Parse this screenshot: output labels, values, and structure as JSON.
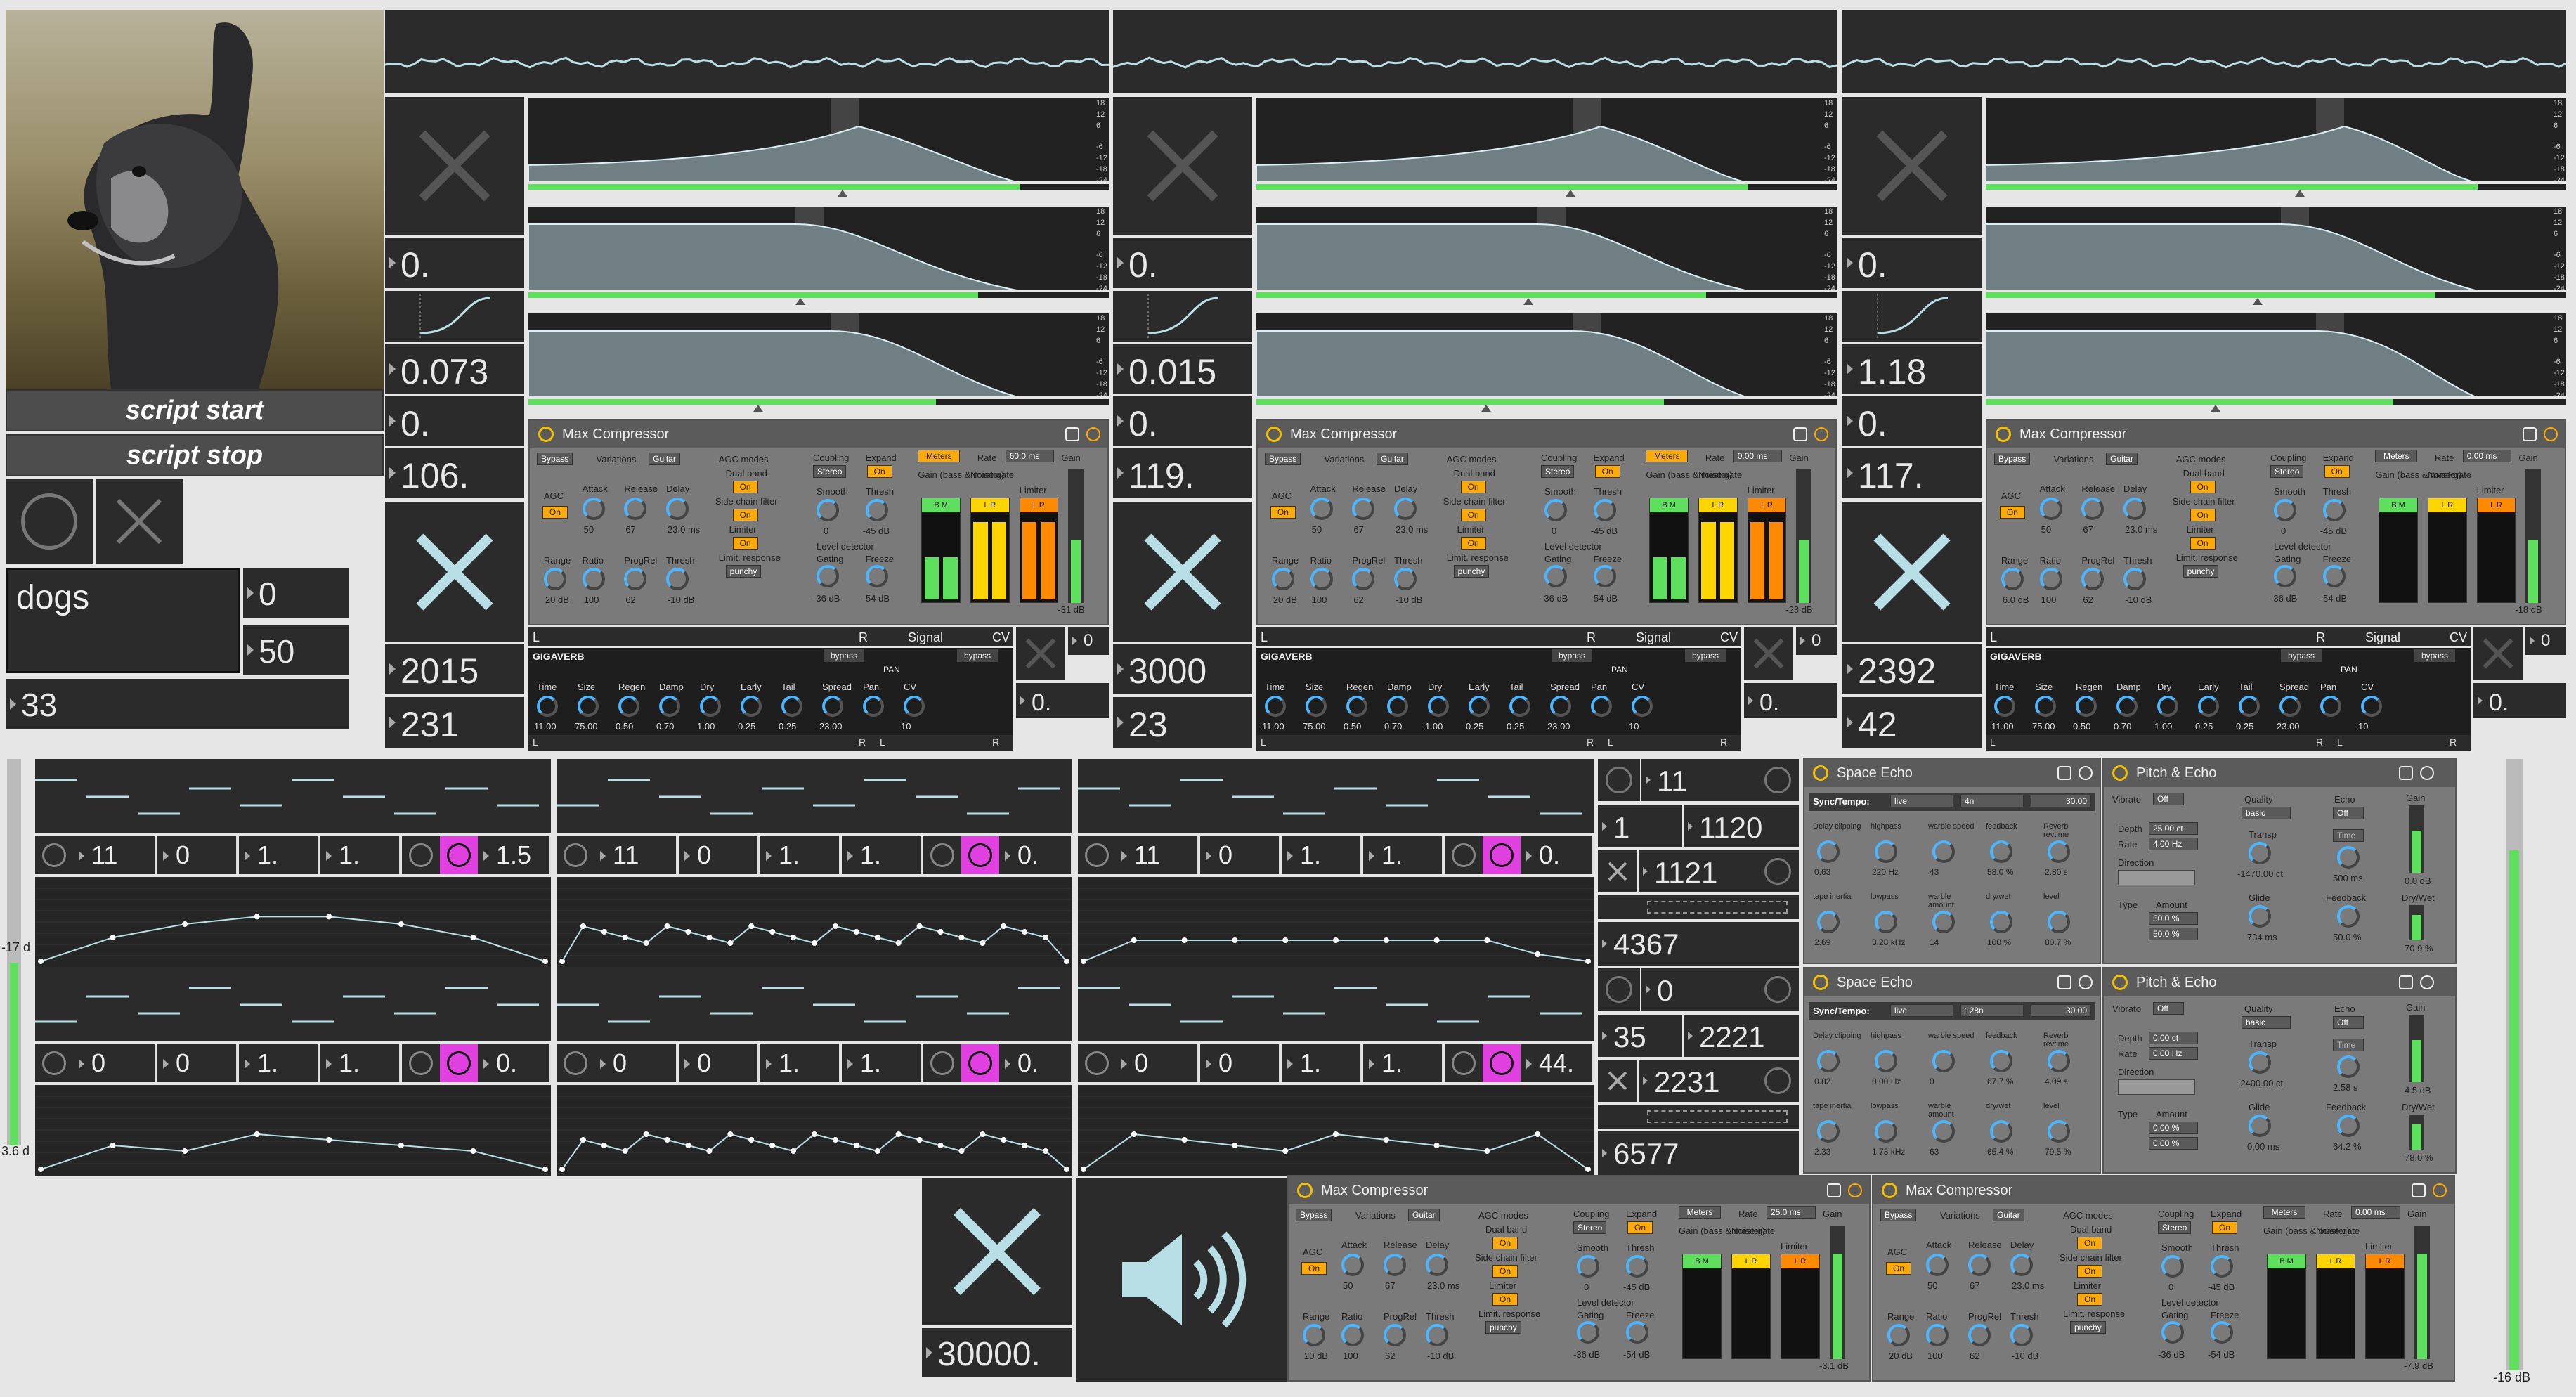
{
  "scripts": {
    "start": "script start",
    "stop": "script stop"
  },
  "text": {
    "word": "dogs",
    "n0": "0",
    "n50": "50",
    "n33": "33"
  },
  "ch": [
    {
      "a": "0.",
      "b": "0.073",
      "c": "0.",
      "d": "106.",
      "e": "2015",
      "f": "231",
      "g": "0",
      "h": "0."
    },
    {
      "a": "0.",
      "b": "0.015",
      "c": "0.",
      "d": "119.",
      "e": "3000",
      "f": "23",
      "g": "0",
      "h": "0."
    },
    {
      "a": "0.",
      "b": "1.18",
      "c": "0.",
      "d": "117.",
      "e": "2392",
      "f": "42",
      "g": "0",
      "h": "0."
    }
  ],
  "dbticks": [
    "18",
    "12",
    "6",
    "-6",
    "-12",
    "-18",
    "-24"
  ],
  "comp": {
    "title": "Max Compressor",
    "bypass": "Bypass",
    "variations": "Variations",
    "guitar": "Guitar",
    "agcmodes": "AGC modes",
    "dualband": "Dual band",
    "on": "On",
    "agc": "AGC",
    "sidechain": "Side chain filter",
    "limiter": "Limiter",
    "limitresp": "Limit. response",
    "punchy": "punchy",
    "coupling": "Coupling",
    "stereo": "Stereo",
    "expand": "Expand",
    "meters": "Meters",
    "rate": "Rate",
    "smooth": "Smooth",
    "thresh": "Thresh",
    "level": "Level detector",
    "gating": "Gating",
    "freeze": "Freeze",
    "gainbm": "Gain (bass & master)",
    "noisegate": "Noise gate",
    "gain": "Gain",
    "attack": "Attack",
    "release": "Release",
    "delay": "Delay",
    "range": "Range",
    "ratio": "Ratio",
    "progrel": "ProgRel",
    "v_attack": "50",
    "v_release": "67",
    "v_delay": "23.0 ms",
    "v_range": "20 dB",
    "v_ratio": "100",
    "v_progrel": "62",
    "v_thresh": "-10 dB",
    "v_smooth": "0",
    "v_thr2": "-45 dB",
    "v_gating": "-36 dB",
    "v_freeze": "-54 dB",
    "bm": "B M",
    "lr": "L R",
    "rates": [
      "60.0 ms",
      "0.00 ms",
      "0.00 ms",
      "25.0 ms",
      "0.00 ms"
    ],
    "gains": [
      "-31 dB",
      "-23 dB",
      "-18 dB",
      "-3.1 dB",
      "-7.9 dB"
    ],
    "range3": "6.0 dB"
  },
  "strip": {
    "l": "L",
    "r": "R",
    "signal": "Signal",
    "cv": "CV"
  },
  "gigaverb": {
    "title": "GIGAVERB",
    "bypass": "bypass",
    "pan": "PAN",
    "labels": [
      "Time",
      "Size",
      "Regen",
      "Damp",
      "Dry",
      "Early",
      "Tail",
      "Spread",
      "Pan",
      "CV"
    ],
    "values": [
      "11.00",
      "75.00",
      "0.50",
      "0.70",
      "1.00",
      "0.25",
      "0.25",
      "23.00",
      "",
      "10"
    ]
  },
  "seq": [
    {
      "a": "11",
      "b": "0",
      "c": "1.",
      "d": "1.",
      "e": "1.5"
    },
    {
      "a": "11",
      "b": "0",
      "c": "1.",
      "d": "1.",
      "e": "0."
    },
    {
      "a": "11",
      "b": "0",
      "c": "1.",
      "d": "1.",
      "e": "0."
    },
    {
      "a": "0",
      "b": "0",
      "c": "1.",
      "d": "1.",
      "e": "0."
    },
    {
      "a": "0",
      "b": "0",
      "c": "1.",
      "d": "1.",
      "e": "0."
    },
    {
      "a": "0",
      "b": "0",
      "c": "1.",
      "d": "1.",
      "e": "44."
    }
  ],
  "leftmeter": {
    "top": "-17 d",
    "bot": "3.6 d"
  },
  "rightmeter": "-16 dB",
  "mid": {
    "a": "11",
    "b": "1",
    "c": "1120",
    "d": "1121",
    "e": "4367",
    "f": "0",
    "g": "35",
    "h": "2221",
    "i": "2231",
    "j": "6577"
  },
  "bigvalue": "30000.",
  "space": {
    "title": "Space Echo",
    "sync": "Sync/Tempo:",
    "live": "live",
    "div1": "4n",
    "div2": "128n",
    "bpm": "30.00",
    "labels": [
      "Delay clipping",
      "highpass",
      "warble speed",
      "feedback",
      "Reverb revtime",
      "tape inertia",
      "lowpass",
      "warble amount",
      "dry/wet",
      "level"
    ],
    "v1": [
      "0.63",
      "220 Hz",
      "43",
      "58.0 %",
      "2.80 s",
      "2.69",
      "3.28 kHz",
      "14",
      "100 %",
      "80.7 %"
    ],
    "v2": [
      "0.82",
      "0.00 Hz",
      "0",
      "67.7 %",
      "4.09 s",
      "2.33",
      "1.73 kHz",
      "63",
      "65.4 %",
      "79.5 %"
    ]
  },
  "pitch": {
    "title": "Pitch & Echo",
    "vibrato": "Vibrato",
    "off": "Off",
    "depth": "Depth",
    "rate": "Rate",
    "direction": "Direction",
    "type": "Type",
    "amount": "Amount",
    "quality": "Quality",
    "basic": "basic",
    "transp": "Transp",
    "glide": "Glide",
    "echo": "Echo",
    "time": "Time",
    "feedback": "Feedback",
    "gain": "Gain",
    "drywet": "Dry/Wet",
    "p1": {
      "depth": "25.00 ct",
      "rate": "4.00 Hz",
      "a1": "50.0 %",
      "a2": "50.0 %",
      "transp": "-1470.00 ct",
      "glide": "734 ms",
      "time": "500 ms",
      "fb": "50.0 %",
      "gain": "0.0 dB",
      "dw": "70.9 %"
    },
    "p2": {
      "depth": "0.00 ct",
      "rate": "0.00 Hz",
      "a1": "0.00 %",
      "a2": "0.00 %",
      "transp": "-2400.00 ct",
      "glide": "0.00 ms",
      "time": "2.58 s",
      "fb": "64.2 %",
      "gain": "4.5 dB",
      "dw": "78.0 %"
    }
  },
  "colors": {
    "accent": "#4bb5ff",
    "orange": "#ffaa00",
    "meterGreen": "#5ee05e",
    "magenta": "#e040e0",
    "panel": "#2b2b2b"
  }
}
